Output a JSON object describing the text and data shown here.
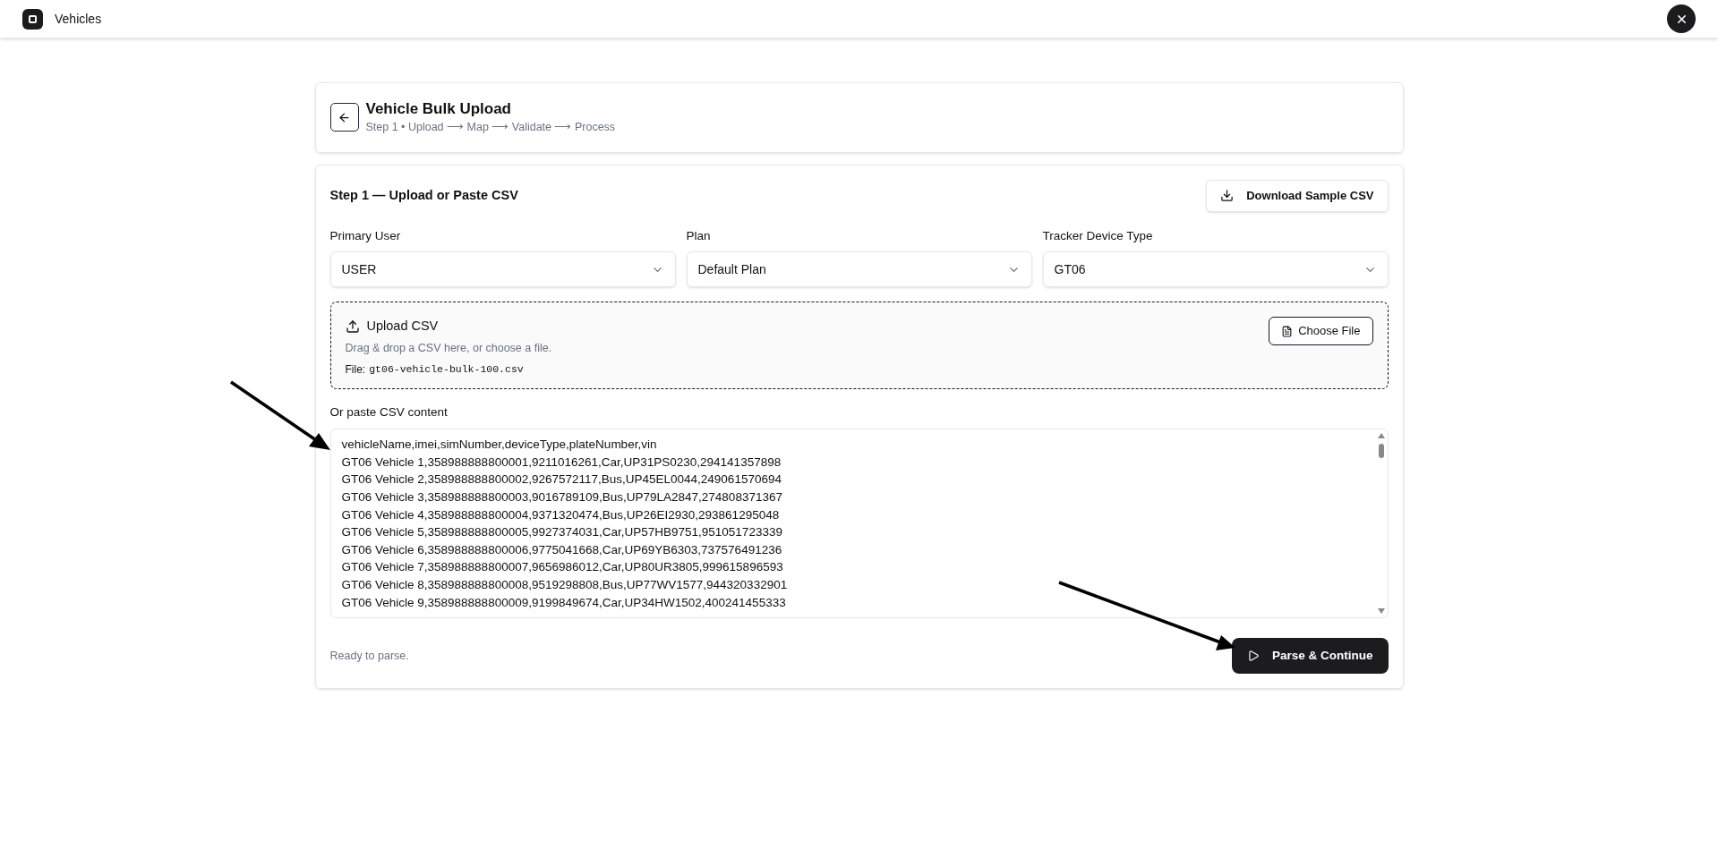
{
  "app_bar": {
    "title": "Vehicles"
  },
  "header": {
    "title": "Vehicle Bulk Upload",
    "subtitle": "Step 1 • Upload ⟶ Map ⟶ Validate ⟶ Process"
  },
  "step": {
    "title": "Step 1 — Upload or Paste CSV",
    "download_button": "Download Sample CSV"
  },
  "selects": [
    {
      "label": "Primary User",
      "value": "USER"
    },
    {
      "label": "Plan",
      "value": "Default Plan"
    },
    {
      "label": "Tracker Device Type",
      "value": "GT06"
    }
  ],
  "upload": {
    "title": "Upload CSV",
    "hint": "Drag & drop a CSV here, or choose a file.",
    "file_label": "File:",
    "file_name": "gt06-vehicle-bulk-100.csv",
    "choose_button": "Choose File"
  },
  "paste": {
    "label": "Or paste CSV content",
    "lines": [
      "vehicleName,imei,simNumber,deviceType,plateNumber,vin",
      "GT06 Vehicle 1,358988888800001,9211016261,Car,UP31PS0230,294141357898",
      "GT06 Vehicle 2,358988888800002,9267572117,Bus,UP45EL0044,249061570694",
      "GT06 Vehicle 3,358988888800003,9016789109,Bus,UP79LA2847,274808371367",
      "GT06 Vehicle 4,358988888800004,9371320474,Bus,UP26EI2930,293861295048",
      "GT06 Vehicle 5,358988888800005,9927374031,Car,UP57HB9751,951051723339",
      "GT06 Vehicle 6,358988888800006,9775041668,Car,UP69YB6303,737576491236",
      "GT06 Vehicle 7,358988888800007,9656986012,Car,UP80UR3805,999615896593",
      "GT06 Vehicle 8,358988888800008,9519298808,Bus,UP77WV1577,944320332901",
      "GT06 Vehicle 9,358988888800009,9199849674,Car,UP34HW1502,400241455333"
    ]
  },
  "footer": {
    "status": "Ready to parse.",
    "primary_button": "Parse & Continue"
  }
}
